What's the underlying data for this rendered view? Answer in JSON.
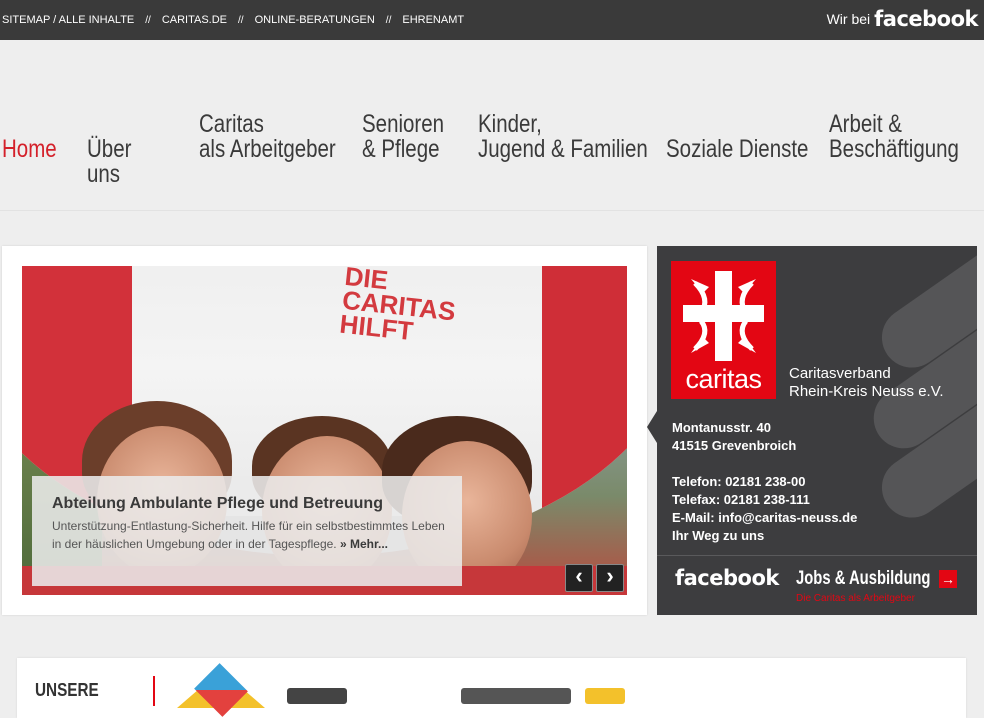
{
  "topbar": {
    "links": [
      "SITEMAP / ALLE INHALTE",
      "CARITAS.DE",
      "ONLINE-BERATUNGEN",
      "EHRENAMT"
    ],
    "separator": "//",
    "facebook_prefix": "Wir bei",
    "facebook_word": "facebook",
    "bg_color": "#3a3a3a"
  },
  "nav": {
    "items": [
      {
        "line1": "Home",
        "line2": ""
      },
      {
        "line1": "Über",
        "line2": "uns"
      },
      {
        "line1": "Caritas",
        "line2": "als Arbeitgeber"
      },
      {
        "line1": "Senioren",
        "line2": "& Pflege"
      },
      {
        "line1": "Kinder,",
        "line2": "Jugend & Familien"
      },
      {
        "line1": "Soziale Dienste",
        "line2": ""
      },
      {
        "line1": "Arbeit &",
        "line2": "Beschäftigung"
      }
    ],
    "active_color": "#d4202a"
  },
  "slider": {
    "image_text": "DIE CARITAS HILFT",
    "caption_title": "Abteilung Ambulante Pflege und Betreuung",
    "caption_text": "Unterstützung-Entlastung-Sicherheit. Hilfe für ein selbstbestimmtes Leben in der häuslichen Umgebung oder in der Tagespflege.",
    "more_label": "» Mehr...",
    "prev_label": "‹",
    "next_label": "›"
  },
  "info": {
    "logo_word": "caritas",
    "org_line1": "Caritasverband",
    "org_line2": "Rhein-Kreis Neuss e.V.",
    "street": "Montanusstr. 40",
    "city": "41515 Grevenbroich",
    "phone": "Telefon: 02181 238-00",
    "fax": "Telefax: 02181 238-111",
    "email": "E-Mail: info@caritas-neuss.de",
    "route": "Ihr Weg zu uns",
    "facebook_word": "facebook",
    "jobs_label": "Jobs & Ausbildung",
    "jobs_sub": "Die Caritas als Arbeitgeber",
    "brand_red": "#e30613"
  },
  "bottom": {
    "label": "UNSERE"
  }
}
